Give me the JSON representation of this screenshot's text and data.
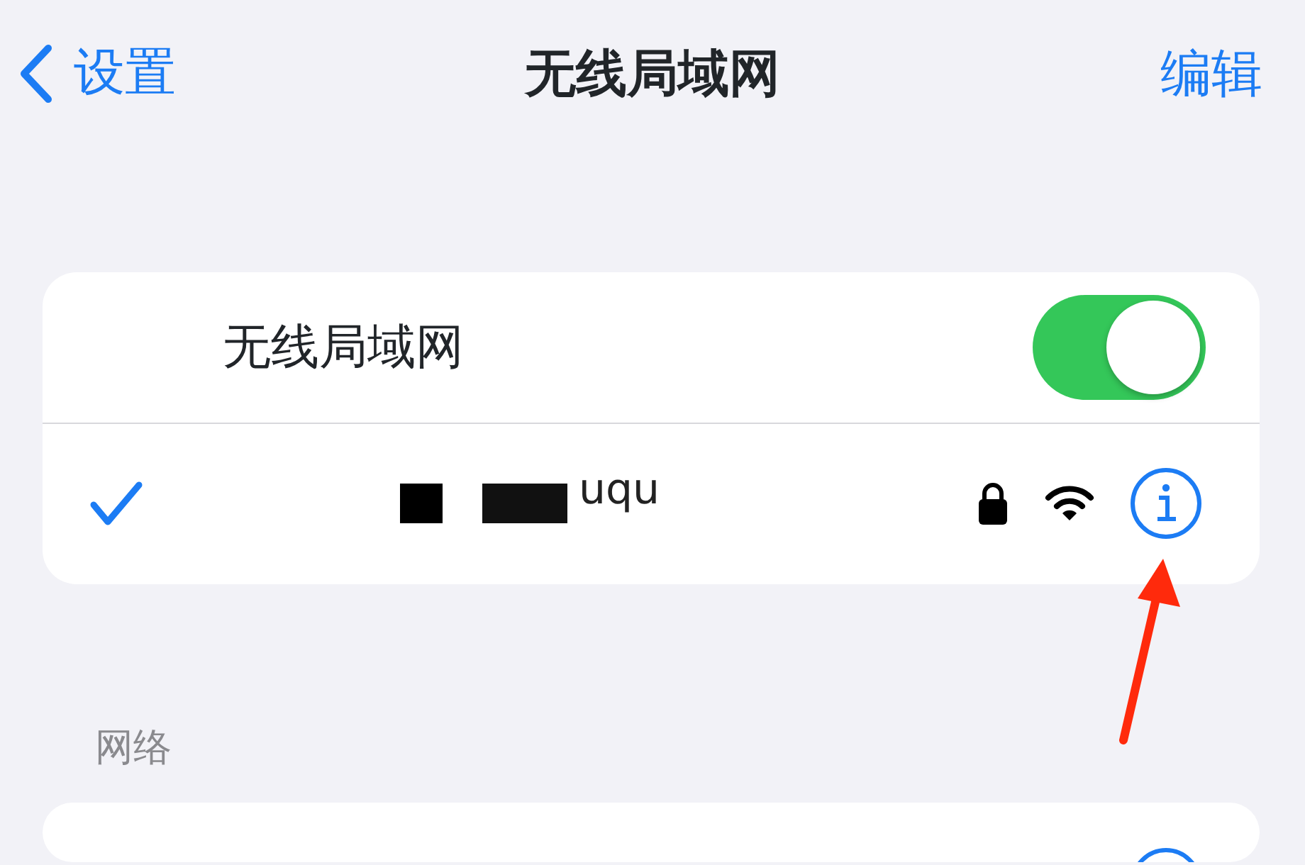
{
  "nav_bar": {
    "back_label": "设置",
    "title": "无线局域网",
    "edit_label": "编辑"
  },
  "wifi_card": {
    "toggle": {
      "label": "无线局域网",
      "on": true
    },
    "current_network": {
      "name": "uqu",
      "checked": true,
      "secured": true
    }
  },
  "networks_section": {
    "header": "网络"
  }
}
